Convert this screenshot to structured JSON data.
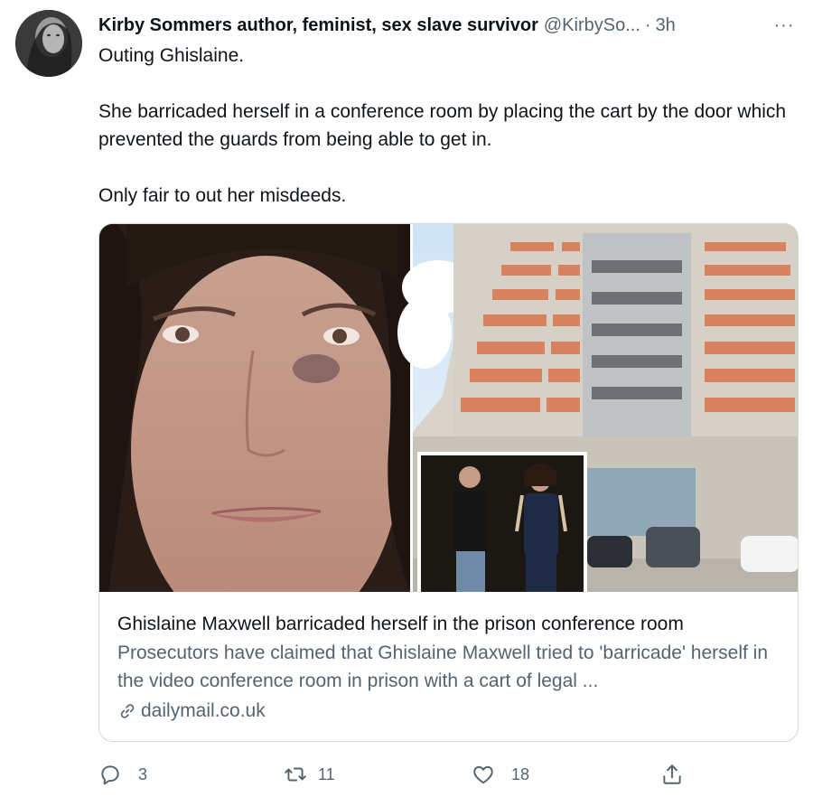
{
  "tweet": {
    "author_name": "Kirby Sommers author, feminist, sex slave survivor",
    "handle": "@KirbySo...",
    "separator": "·",
    "time": "3h",
    "more_label": "···",
    "text_lines": [
      "Outing Ghislaine.",
      "She barricaded herself in a conference room by placing the cart by the door which prevented the guards from being able to get in.",
      "Only fair to out her misdeeds."
    ]
  },
  "card": {
    "title": "Ghislaine Maxwell barricaded herself in the prison conference room",
    "description": "Prosecutors have claimed that Ghislaine Maxwell tried to 'barricade' herself in the video conference room in prison with a cart of legal ...",
    "domain": "dailymail.co.uk"
  },
  "actions": {
    "reply_count": "3",
    "retweet_count": "11",
    "like_count": "18"
  },
  "icons": {
    "reply": "reply-icon",
    "retweet": "retweet-icon",
    "like": "heart-icon",
    "share": "share-icon",
    "link": "link-icon",
    "more": "more-icon"
  },
  "colors": {
    "text": "#0f1419",
    "secondary": "#536471",
    "border": "#cfd9de"
  }
}
